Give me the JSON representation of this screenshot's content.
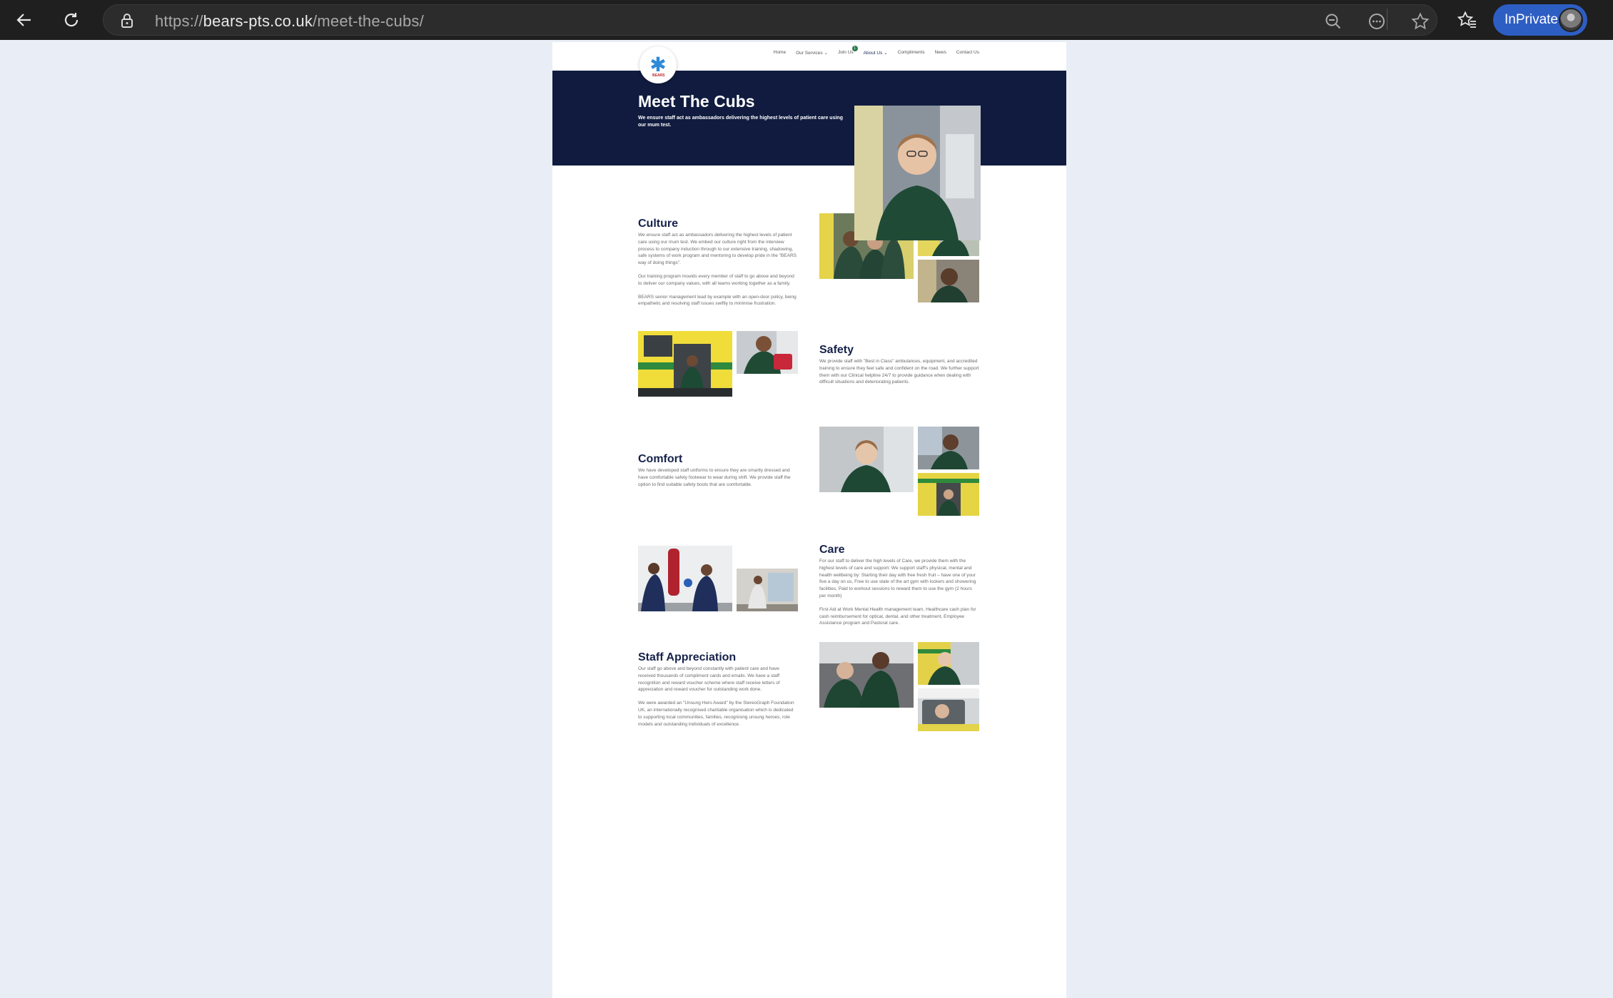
{
  "browser": {
    "url_prefix": "https://",
    "url_domain": "bears-pts.co.uk",
    "url_path": "/meet-the-cubs/",
    "inprivate_label": "InPrivate",
    "icons": [
      "back-icon",
      "refresh-icon",
      "lock-icon",
      "zoom-out-icon",
      "more-icon",
      "favorite-icon",
      "favorites-icon"
    ]
  },
  "site": {
    "logo_text": "BEARS",
    "nav": {
      "home": "Home",
      "services": "Our Services",
      "join": "Join Us",
      "join_badge": "1",
      "about": "About Us",
      "compliments": "Compliments",
      "news": "News",
      "contact": "Contact Us"
    }
  },
  "hero": {
    "title": "Meet The Cubs",
    "subtitle": "We ensure staff act as ambassadors delivering the highest levels of patient care using our mum test."
  },
  "sections": {
    "culture": {
      "title": "Culture",
      "p1": "We ensure staff act as ambassadors delivering the highest levels of patient care using our mum test. We embed our culture right from the interview process to company induction through to our extensive training, shadowing, safe systems of work program and mentoring to develop pride in the \"BEARS way of doing things\".",
      "p2": "Our training program moulds every member of staff to go above and beyond to deliver our company values, with all teams working together as a family.",
      "p3": "BEARS senior management lead by example with an open-door policy, being empathetic and resolving staff issues swiftly to minimise frustration."
    },
    "safety": {
      "title": "Safety",
      "p1": "We provide staff with \"Best in Class\" ambulances, equipment, and accredited training to ensure they feel safe and confident on the road. We further support them with our Clinical helpline 24/7 to provide guidance when dealing with difficult situations and deteriorating patients."
    },
    "comfort": {
      "title": "Comfort",
      "p1": "We have developed staff uniforms to ensure they are smartly dressed and have comfortable safety footwear to wear during shift. We provide staff the option to find suitable safety boots that are comfortable."
    },
    "care": {
      "title": "Care",
      "p1": "For our staff to deliver the high levels of Care, we provide them with the highest levels of care and support. We support staff's physical, mental and health wellbeing by: Starting their day with free fresh fruit – have one of your five a day on us, Free to use state of the art gym with lockers and showering facilities, Paid to workout sessions to reward them to use the gym (2 hours per month)",
      "p2": "First Aid at Work Mental Health management team, Healthcare cash plan for cash reimbursement for optical, dental, and other treatment, Employee Assistance program and Pastoral care."
    },
    "appreciation": {
      "title": "Staff Appreciation",
      "p1": "Our staff go above and beyond constantly with patient care and have received thousands of compliment cards and emails. We have a staff recognition and reward voucher scheme where staff receive letters of appreciation and reward voucher for outstanding work done.",
      "p2": "We were awarded an \"Unsung Hero Award\" by the StereoGraph Foundation UK, an internationally recognised charitable organisation which is dedicated to supporting local communities, families, recognising unsung heroes, role models and outstanding individuals of excellence."
    }
  }
}
